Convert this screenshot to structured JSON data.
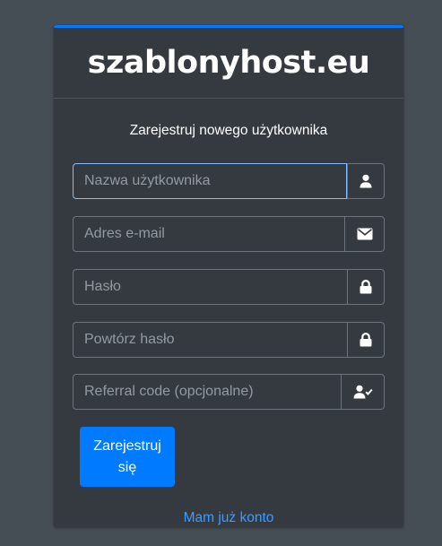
{
  "brand": {
    "title": "szablonyhost.eu"
  },
  "form": {
    "subtitle": "Zarejestruj nowego użytkownika",
    "fields": [
      {
        "placeholder": "Nazwa użytkownika",
        "value": "",
        "icon": "user-icon"
      },
      {
        "placeholder": "Adres e-mail",
        "value": "",
        "icon": "envelope-icon"
      },
      {
        "placeholder": "Hasło",
        "value": "",
        "icon": "lock-icon"
      },
      {
        "placeholder": "Powtórz hasło",
        "value": "",
        "icon": "lock-icon"
      },
      {
        "placeholder": "Referral code (opcjonalne)",
        "value": "",
        "icon": "user-check-icon"
      }
    ],
    "submit_label": "Zarejestruj się",
    "login_link": "Mam już konto"
  },
  "colors": {
    "background": "#454d55",
    "card": "#343a40",
    "accent": "#007bff",
    "focus_border": "#80bdff",
    "link": "#3f9bff"
  }
}
